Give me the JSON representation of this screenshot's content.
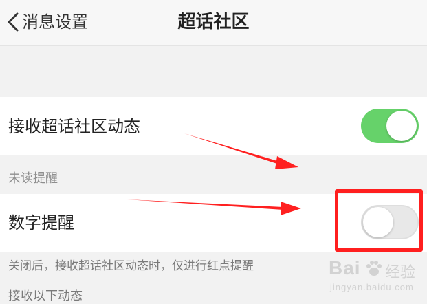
{
  "nav": {
    "back_label": "消息设置",
    "title": "超话社区"
  },
  "settings": {
    "receive_updates": {
      "label": "接收超话社区动态",
      "enabled": true
    },
    "unread_section_header": "未读提醒",
    "digit_reminder": {
      "label": "数字提醒",
      "enabled": false
    },
    "footer_note": "关闭后，接收超话社区动态时，仅进行红点提醒",
    "next_section_header": "接收以下动态"
  },
  "annotations": {
    "arrow_color": "#ff2020",
    "highlight_color": "#ff1f1f"
  },
  "watermark": {
    "brand": "Bai",
    "brand_suffix": "经验",
    "url": "jingyan.baidu.com"
  },
  "colors": {
    "toggle_on": "#66d26a",
    "toggle_off": "#e8e8e8",
    "background": "#f2f2f2"
  }
}
